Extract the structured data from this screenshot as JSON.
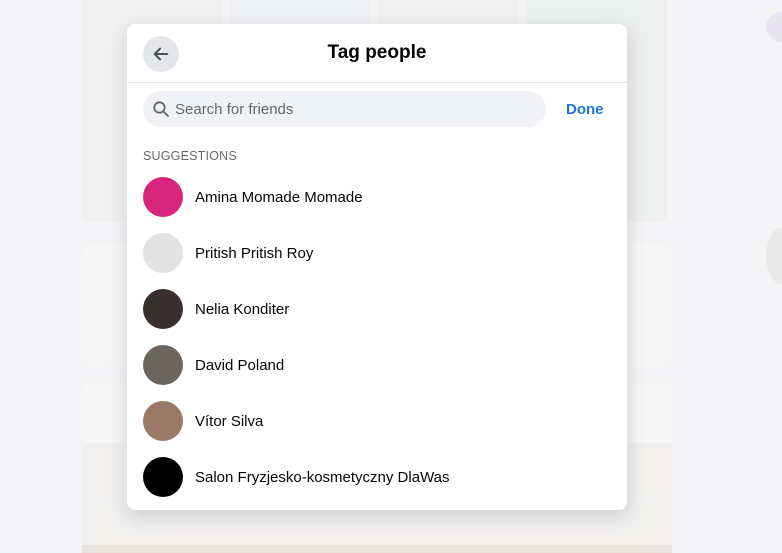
{
  "dialog": {
    "title": "Tag people",
    "back_icon": "arrow-left-icon",
    "search_placeholder": "Search for friends",
    "search_value": "",
    "done_label": "Done",
    "suggestions_label": "SUGGESTIONS"
  },
  "suggestions": [
    {
      "name": "Amina Momade Momade",
      "avatar_color": "#d8267c"
    },
    {
      "name": "Pritish Pritish Roy",
      "avatar_color": "#e2e2e2"
    },
    {
      "name": "Nelia Konditer",
      "avatar_color": "#3a2f2f"
    },
    {
      "name": "David Poland",
      "avatar_color": "#6d6460"
    },
    {
      "name": "Vítor Silva",
      "avatar_color": "#9a7a66"
    },
    {
      "name": "Salon Fryzjesko-kosmetyczny DlaWas",
      "avatar_color": "#000000"
    }
  ],
  "colors": {
    "accent": "#1b74e4",
    "search_bg": "#f0f2f5"
  }
}
